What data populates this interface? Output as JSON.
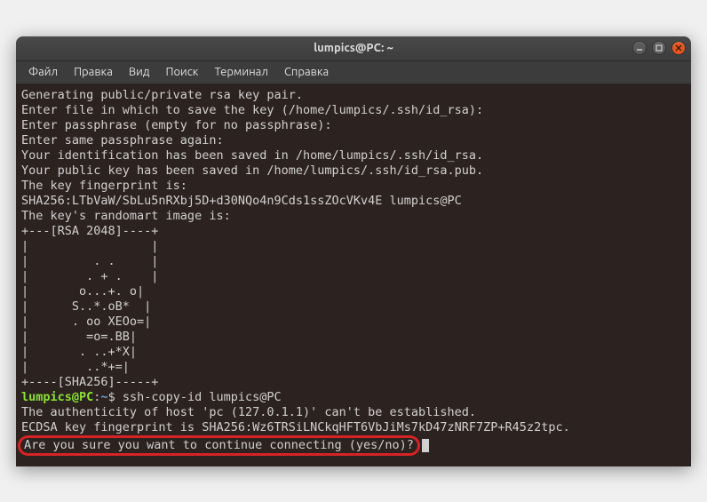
{
  "window": {
    "title": "lumpics@PC: ~"
  },
  "menu": {
    "file": "Файл",
    "edit": "Правка",
    "view": "Вид",
    "search": "Поиск",
    "terminal": "Терминал",
    "help": "Справка"
  },
  "terminal": {
    "line1": "Generating public/private rsa key pair.",
    "line2": "Enter file in which to save the key (/home/lumpics/.ssh/id_rsa):",
    "line3": "Enter passphrase (empty for no passphrase):",
    "line4": "Enter same passphrase again:",
    "line5": "Your identification has been saved in /home/lumpics/.ssh/id_rsa.",
    "line6": "Your public key has been saved in /home/lumpics/.ssh/id_rsa.pub.",
    "line7": "The key fingerprint is:",
    "line8": "SHA256:LTbVaW/SbLu5nRXbj5D+d30NQo4n9Cds1ssZOcVKv4E lumpics@PC",
    "line9": "The key's randomart image is:",
    "line10": "+---[RSA 2048]----+",
    "line11": "|                 |",
    "line12": "|         . .     |",
    "line13": "|        . + .    |",
    "line14": "|       o...+. o|",
    "line15": "|      S..*.oB*  |",
    "line16": "|      . oo XEOo=|",
    "line17": "|        =o=.BB|",
    "line18": "|       . ..+*X|",
    "line19": "|        ..*+=|",
    "line20": "+----[SHA256]-----+",
    "prompt_user": "lumpics@PC",
    "prompt_sep": ":",
    "prompt_path": "~",
    "prompt_dollar": "$ ",
    "command": "ssh-copy-id lumpics@PC",
    "line22": "The authenticity of host 'pc (127.0.1.1)' can't be established.",
    "line23": "ECDSA key fingerprint is SHA256:Wz6TRSiLNCkqHFT6VbJiMs7kD47zNRF7ZP+R45z2tpc.",
    "line24": "Are you sure you want to continue connecting (yes/no)?"
  }
}
